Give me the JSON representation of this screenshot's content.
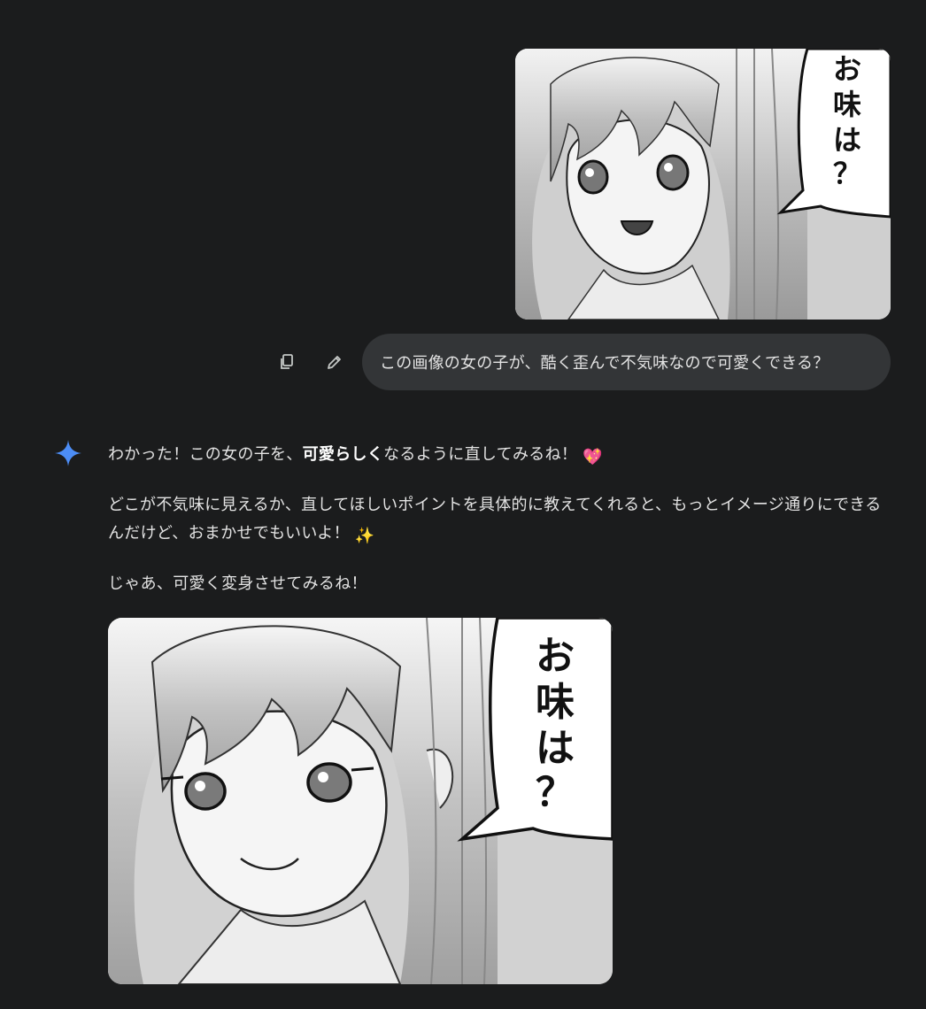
{
  "user_message": {
    "image": {
      "speech_text": [
        "お",
        "味",
        "は",
        "？"
      ]
    },
    "text": "この画像の女の子が、酷く歪んで不気味なので可愛くできる？",
    "actions": {
      "copy_icon": "copy-icon",
      "edit_icon": "pencil-icon"
    }
  },
  "model_response": {
    "icon": "gemini-sparkle-icon",
    "p1_before": "わかった！この女の子を、",
    "p1_bold": "可愛らしく",
    "p1_after": "なるように直してみるね！",
    "p1_emoji": "💖",
    "p2_text": "どこが不気味に見えるか、直してほしいポイントを具体的に教えてくれると、もっとイメージ通りにできるんだけど、おまかせでもいいよ！",
    "p2_emoji": "✨",
    "p3_text": "じゃあ、可愛く変身させてみるね！",
    "image": {
      "speech_text": [
        "お",
        "味",
        "は",
        "？"
      ]
    }
  },
  "colors": {
    "background": "#1b1c1d",
    "bubble": "#333537",
    "text": "#e3e3e3",
    "sparkle": "#4c8df6"
  }
}
